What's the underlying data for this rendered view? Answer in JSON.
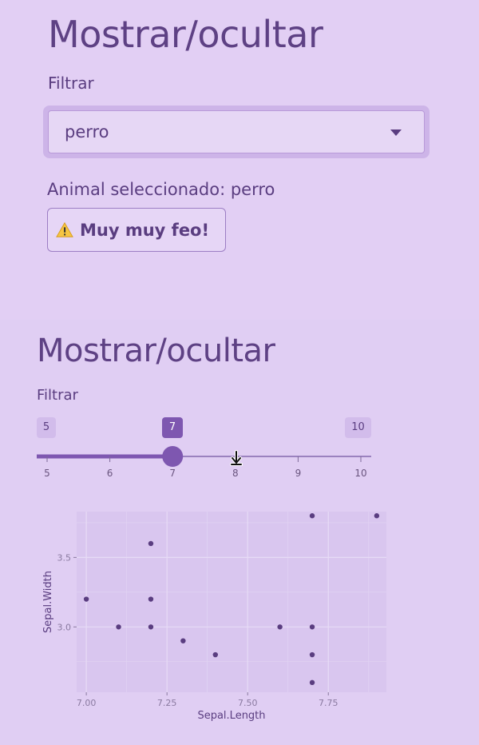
{
  "section1": {
    "title": "Mostrar/ocultar",
    "filter_label": "Filtrar",
    "select_value": "perro",
    "selected_text": "Animal seleccionado: perro",
    "button_label": "Muy muy feo!",
    "button_icon": "warning-icon"
  },
  "section2": {
    "title": "Mostrar/ocultar",
    "filter_label": "Filtrar",
    "slider": {
      "min": 5,
      "max": 10,
      "value": 7,
      "min_label": "5",
      "max_label": "10",
      "value_label": "7",
      "ticks": [
        "5",
        "6",
        "7",
        "8",
        "9",
        "10"
      ]
    }
  },
  "colors": {
    "accent": "#7e57b0",
    "text": "#5a3d80",
    "background": "#e2d0f4",
    "plot_panel": "#d9c6ef",
    "grid": "#e7dbf6",
    "point": "#5a3d80"
  },
  "chart_data": {
    "type": "scatter",
    "xlabel": "Sepal.Length",
    "ylabel": "Sepal.Width",
    "xlim": [
      6.97,
      7.93
    ],
    "ylim": [
      2.53,
      3.83
    ],
    "xticks": [
      7.0,
      7.25,
      7.5,
      7.75
    ],
    "xtick_labels": [
      "7.00",
      "7.25",
      "7.50",
      "7.75"
    ],
    "yticks": [
      3.0,
      3.5
    ],
    "ytick_labels": [
      "3.0",
      "3.5"
    ],
    "grid": true,
    "points": [
      {
        "x": 7.0,
        "y": 3.2
      },
      {
        "x": 7.1,
        "y": 3.0
      },
      {
        "x": 7.2,
        "y": 3.6
      },
      {
        "x": 7.2,
        "y": 3.2
      },
      {
        "x": 7.2,
        "y": 3.0
      },
      {
        "x": 7.3,
        "y": 2.9
      },
      {
        "x": 7.4,
        "y": 2.8
      },
      {
        "x": 7.6,
        "y": 3.0
      },
      {
        "x": 7.7,
        "y": 3.8
      },
      {
        "x": 7.7,
        "y": 3.0
      },
      {
        "x": 7.7,
        "y": 2.8
      },
      {
        "x": 7.7,
        "y": 2.6
      },
      {
        "x": 7.9,
        "y": 3.8
      }
    ]
  }
}
